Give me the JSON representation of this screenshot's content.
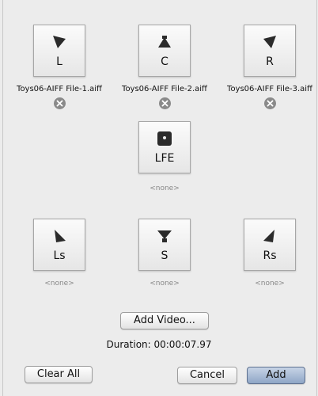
{
  "channels": {
    "L": {
      "label": "L",
      "file": "Toys06-AIFF File-1.aiff",
      "icon": "speaker-left-icon"
    },
    "C": {
      "label": "C",
      "file": "Toys06-AIFF File-2.aiff",
      "icon": "speaker-center-icon"
    },
    "R": {
      "label": "R",
      "file": "Toys06-AIFF File-3.aiff",
      "icon": "speaker-right-icon"
    },
    "LFE": {
      "label": "LFE",
      "file": "<none>",
      "icon": "subwoofer-icon"
    },
    "Ls": {
      "label": "Ls",
      "file": "<none>",
      "icon": "speaker-left-surround-icon"
    },
    "S": {
      "label": "S",
      "file": "<none>",
      "icon": "speaker-surround-icon"
    },
    "Rs": {
      "label": "Rs",
      "file": "<none>",
      "icon": "speaker-right-surround-icon"
    }
  },
  "buttons": {
    "add_video": "Add Video...",
    "clear_all": "Clear All",
    "cancel": "Cancel",
    "add": "Add"
  },
  "duration": "Duration: 00:00:07.97",
  "colors": {
    "background": "#ececec",
    "icon": "#2b2b2b",
    "remove_button": "#8a8a8a",
    "primary_button": "#9fb3cf"
  }
}
